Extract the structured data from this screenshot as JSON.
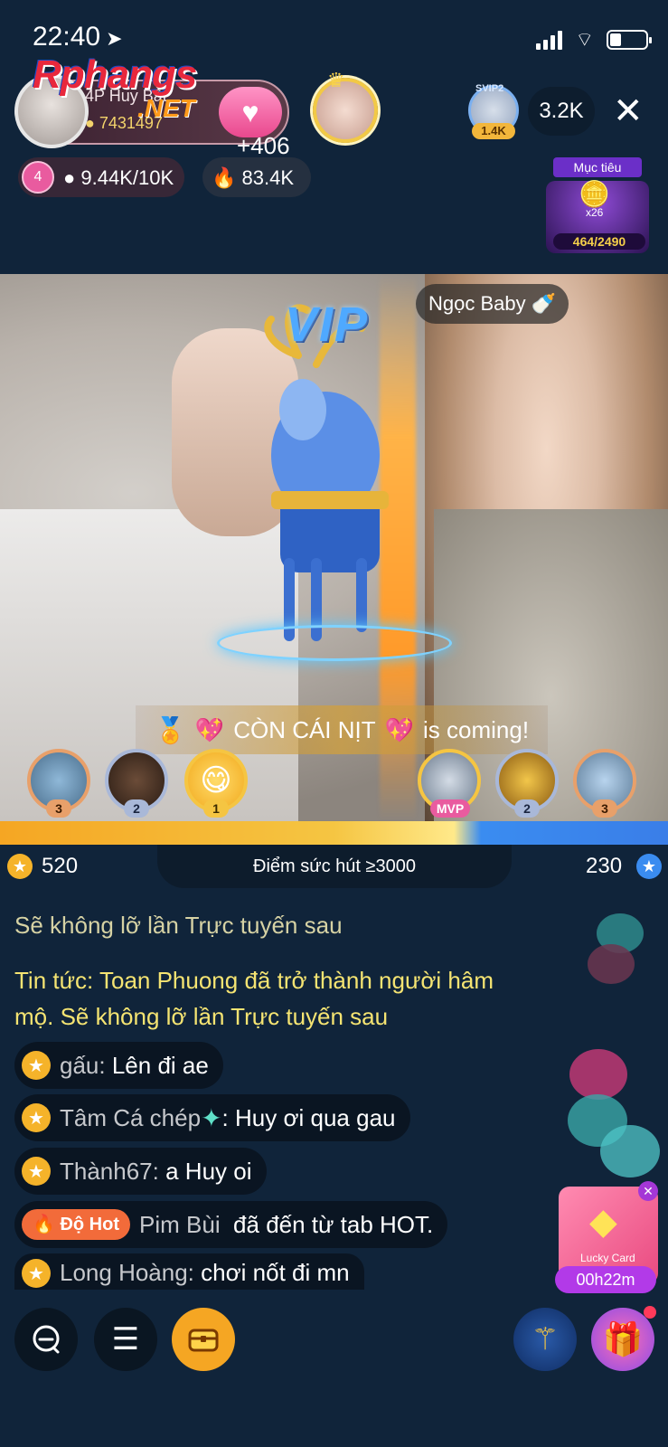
{
  "status_bar": {
    "time": "22:40",
    "location_arrow": "location-arrow-icon"
  },
  "watermark": {
    "logo": "Rphangs",
    "suffix": ".NET"
  },
  "host": {
    "name": "4P Huy Bất",
    "coins": "7431497",
    "crown_gain": "+406",
    "level": "4",
    "level_progress": "9.44K/10K",
    "hot_value": "83.4K"
  },
  "viewers": {
    "top_badge": "SVIP2",
    "top_value": "1.4K",
    "count": "3.2K"
  },
  "target": {
    "label": "Mục tiêu",
    "multiplier": "x26",
    "progress": "464/2490"
  },
  "stream": {
    "guest_name": "Ngọc Baby",
    "guest_icon": "🍼",
    "vip_label": "VIP",
    "banner_user": "CÒN CÁI NỊT",
    "banner_suffix": "is coming!"
  },
  "ranks_left": [
    "3",
    "2",
    "1"
  ],
  "ranks_right": [
    "MVP",
    "2",
    "3"
  ],
  "pk": {
    "left_score": "520",
    "center_label": "Điểm sức hút ≥3000",
    "right_score": "230"
  },
  "chat": {
    "system": "Sẽ không lỡ lần Trực tuyến sau",
    "news": "Tin tức: Toan Phuong đã trở thành người hâm mộ. Sẽ không lỡ lần Trực tuyến sau",
    "messages": [
      {
        "user": "gấu:",
        "text": "Lên đi ae"
      },
      {
        "user": "Tâm Cá chép",
        "text": ": Huy ơi qua gau"
      },
      {
        "user": "Thành67:",
        "text": "a Huy oi"
      },
      {
        "badge": "Độ Hot",
        "user": "Pim Bùi",
        "text": "đã đến từ tab HOT."
      },
      {
        "user": "Long Hoàng:",
        "text": "chơi nốt đi mn"
      }
    ]
  },
  "lucky_card": {
    "label": "Lucky Card",
    "timer": "00h22m"
  },
  "colors": {
    "accent_orange": "#f5a623",
    "accent_blue": "#3a8cf0",
    "news_yellow": "#f5e472",
    "background": "#10243a"
  }
}
